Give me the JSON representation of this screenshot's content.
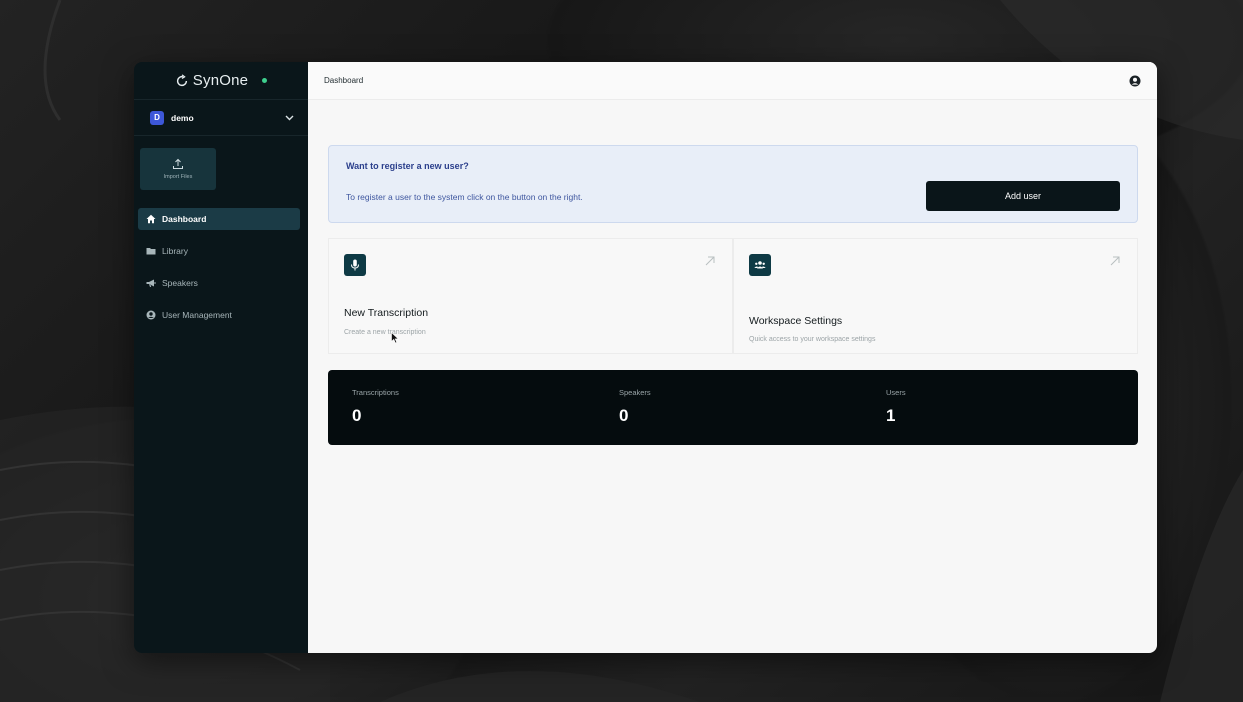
{
  "app": {
    "logo_text": "SynOne",
    "accent_color": "#3ecf8e"
  },
  "workspace": {
    "avatar_letter": "D",
    "name": "demo"
  },
  "sidebar": {
    "import_label": "Import Files",
    "items": [
      {
        "label": "Dashboard",
        "icon": "home-icon",
        "active": true
      },
      {
        "label": "Library",
        "icon": "folder-icon",
        "active": false
      },
      {
        "label": "Speakers",
        "icon": "megaphone-icon",
        "active": false
      },
      {
        "label": "User Management",
        "icon": "user-circle-icon",
        "active": false
      }
    ]
  },
  "header": {
    "title": "Dashboard",
    "user_icon": "user-circle-icon"
  },
  "banner": {
    "title": "Want to register a new user?",
    "text": "To register a user to the system click on the button on the right.",
    "button_label": "Add user"
  },
  "cards": [
    {
      "title": "New Transcription",
      "subtitle": "Create a new transcription",
      "icon": "microphone-icon"
    },
    {
      "title": "Workspace Settings",
      "subtitle": "Quick access to your workspace settings",
      "icon": "users-icon"
    }
  ],
  "stats": [
    {
      "label": "Transcriptions",
      "value": "0"
    },
    {
      "label": "Speakers",
      "value": "0"
    },
    {
      "label": "Users",
      "value": "1"
    }
  ]
}
